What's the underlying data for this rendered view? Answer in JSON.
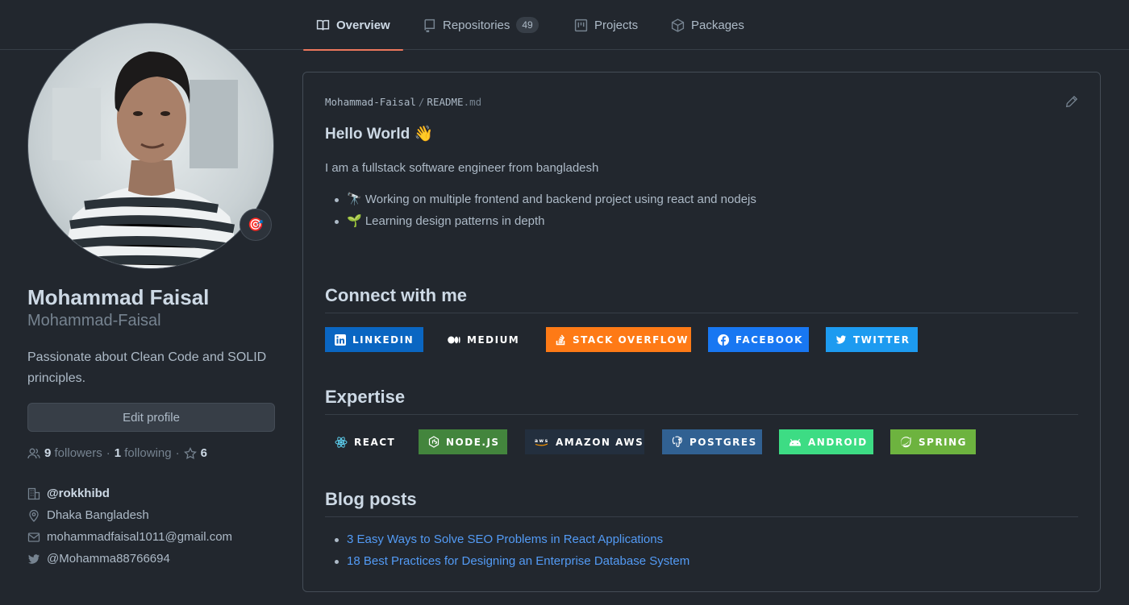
{
  "nav": {
    "tabs": [
      {
        "label": "Overview",
        "icon": "book-icon"
      },
      {
        "label": "Repositories",
        "icon": "repo-icon",
        "count": "49"
      },
      {
        "label": "Projects",
        "icon": "project-icon"
      },
      {
        "label": "Packages",
        "icon": "package-icon"
      }
    ]
  },
  "profile": {
    "status_emoji": "🎯",
    "full_name": "Mohammad Faisal",
    "username": "Mohammad-Faisal",
    "bio": "Passionate about Clean Code and SOLID principles.",
    "edit_label": "Edit profile",
    "followers_count": "9",
    "followers_label": "followers",
    "following_count": "1",
    "following_label": "following",
    "stars_count": "6",
    "organization": "@rokkhibd",
    "location": "Dhaka Bangladesh",
    "email": "mohammadfaisal1011@gmail.com",
    "twitter": "@Mohamma88766694"
  },
  "readme": {
    "owner": "Mohammad-Faisal",
    "separator": "/",
    "file_name": "README",
    "file_ext": ".md",
    "greeting": "Hello World 👋",
    "intro": "I am a fullstack software engineer from bangladesh",
    "bullets": [
      "🔭 Working on multiple frontend and backend project using react and nodejs",
      "🌱 Learning design patterns in depth"
    ],
    "connect_heading": "Connect with me",
    "connect_badges": [
      {
        "label": "LINKEDIN",
        "icon": "linkedin-icon",
        "color": "#0a66c2"
      },
      {
        "label": "MEDIUM",
        "icon": "medium-icon",
        "color": "#22272e"
      },
      {
        "label": "STACK OVERFLOW",
        "icon": "stackoverflow-icon",
        "color": "#fe7a16"
      },
      {
        "label": "FACEBOOK",
        "icon": "facebook-icon",
        "color": "#1877f2"
      },
      {
        "label": "TWITTER",
        "icon": "twitter-icon",
        "color": "#1d9bf0"
      }
    ],
    "expertise_heading": "Expertise",
    "expertise_badges": [
      {
        "label": "REACT",
        "icon": "react-icon",
        "color": "#22272e"
      },
      {
        "label": "NODE.JS",
        "icon": "nodejs-icon",
        "color": "#43853d"
      },
      {
        "label": "AMAZON AWS",
        "icon": "aws-icon",
        "color": "#232f3e"
      },
      {
        "label": "POSTGRES",
        "icon": "postgres-icon",
        "color": "#316192"
      },
      {
        "label": "ANDROID",
        "icon": "android-icon",
        "color": "#3ddc84"
      },
      {
        "label": "SPRING",
        "icon": "spring-icon",
        "color": "#6db33f"
      }
    ],
    "blog_heading": "Blog posts",
    "blog_posts": [
      "3 Easy Ways to Solve SEO Problems in React Applications",
      "18 Best Practices for Designing an Enterprise Database System"
    ]
  },
  "colors": {
    "background": "#22272e",
    "accent_underline": "#ec775c",
    "link": "#539bf5"
  }
}
